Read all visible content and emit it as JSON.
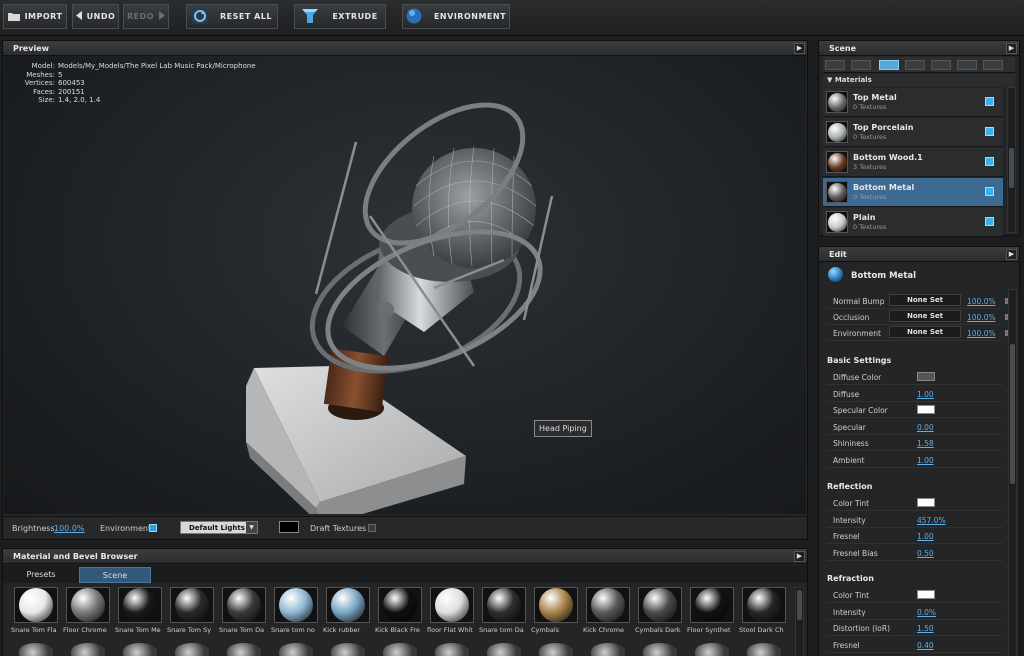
{
  "toolbar": {
    "import": "IMPORT",
    "undo": "UNDO",
    "redo": "REDO",
    "reset_all": "RESET ALL",
    "extrude": "EXTRUDE",
    "environment": "ENVIRONMENT"
  },
  "preview": {
    "title": "Preview",
    "info": [
      {
        "key": "Model:",
        "value": "Models/My_Models/The Pixel Lab Music Pack/Microphone"
      },
      {
        "key": "Meshes:",
        "value": "5"
      },
      {
        "key": "Vertices:",
        "value": "600453"
      },
      {
        "key": "Faces:",
        "value": "200151"
      },
      {
        "key": "Size:",
        "value": "1.4, 2.0, 1.4"
      }
    ],
    "tooltip": "Head Piping"
  },
  "bottom_bar": {
    "brightness_label": "Brightness",
    "brightness_value": "100.0%",
    "environment_label": "Environment",
    "lights_value": "Default Lights",
    "draft_label": "Draft Textures"
  },
  "browser": {
    "title": "Material and Bevel Browser",
    "tabs": [
      "Presets",
      "Scene"
    ],
    "active_tab": "Scene",
    "materials": [
      {
        "label": "Snare Tom Fla",
        "color": "#e8e8e8"
      },
      {
        "label": "Floor Chrome",
        "color": "#7a7a7a"
      },
      {
        "label": "Snare Tom Me",
        "color": "#1a1a1a"
      },
      {
        "label": "Snare Tom Sy",
        "color": "#2a2a2a"
      },
      {
        "label": "Snare Tom Da",
        "color": "#3a3a3a"
      },
      {
        "label": "Snare tom no",
        "color": "#8fb8d4"
      },
      {
        "label": "Kick rubber",
        "color": "#7aa6c4"
      },
      {
        "label": "Kick Black Fre",
        "color": "#0e0e0e"
      },
      {
        "label": "floor Flat Whit",
        "color": "#dedede"
      },
      {
        "label": "Snare tom Da",
        "color": "#2e2e2e"
      },
      {
        "label": "Cymbals",
        "color": "#a8834a"
      },
      {
        "label": "Kick Chrome",
        "color": "#5a5a5a"
      },
      {
        "label": "Cymbals Dark",
        "color": "#4a4a4a"
      },
      {
        "label": "Floor Synthet",
        "color": "#111111"
      },
      {
        "label": "Stool Dark Ch",
        "color": "#262626"
      }
    ]
  },
  "scene": {
    "title": "Scene",
    "materials_header": "Materials",
    "materials": [
      {
        "name": "Top Metal",
        "sub": "0 Textures",
        "color": "#6a6a6a",
        "selected": false
      },
      {
        "name": "Top Porcelain",
        "sub": "0 Textures",
        "color": "#a8aeb0",
        "selected": false
      },
      {
        "name": "Bottom Wood.1",
        "sub": "3 Textures",
        "color": "#6a3a22",
        "selected": false
      },
      {
        "name": "Bottom Metal",
        "sub": "0 Textures",
        "color": "#5a5a5a",
        "selected": true
      },
      {
        "name": "Plain",
        "sub": "0 Textures",
        "color": "#c8c8c8",
        "selected": false
      }
    ]
  },
  "edit": {
    "title": "Edit",
    "material_name": "Bottom Metal",
    "maps": [
      {
        "label": "Normal Bump",
        "value": "None Set",
        "pct": "100.0%"
      },
      {
        "label": "Occlusion",
        "value": "None Set",
        "pct": "100.0%"
      },
      {
        "label": "Environment",
        "value": "None Set",
        "pct": "100.0%"
      }
    ],
    "basic_title": "Basic Settings",
    "basic": [
      {
        "label": "Diffuse Color",
        "type": "swatch",
        "color": "#555555"
      },
      {
        "label": "Diffuse",
        "value": "1.00"
      },
      {
        "label": "Specular Color",
        "type": "swatch",
        "color": "#ffffff"
      },
      {
        "label": "Specular",
        "value": "0.00"
      },
      {
        "label": "Shininess",
        "value": "1.58"
      },
      {
        "label": "Ambient",
        "value": "1.00"
      }
    ],
    "reflection_title": "Reflection",
    "reflection": [
      {
        "label": "Color Tint",
        "type": "swatch",
        "color": "#ffffff"
      },
      {
        "label": "Intensity",
        "value": "457.0%"
      },
      {
        "label": "Fresnel",
        "value": "1.00"
      },
      {
        "label": "Fresnel Bias",
        "value": "0.50"
      }
    ],
    "refraction_title": "Refraction",
    "refraction": [
      {
        "label": "Color Tint",
        "type": "swatch",
        "color": "#ffffff"
      },
      {
        "label": "Intensity",
        "value": "0.0%"
      },
      {
        "label": "Distortion (IoR)",
        "value": "1.50"
      },
      {
        "label": "Fresnel",
        "value": "0.40"
      }
    ]
  }
}
